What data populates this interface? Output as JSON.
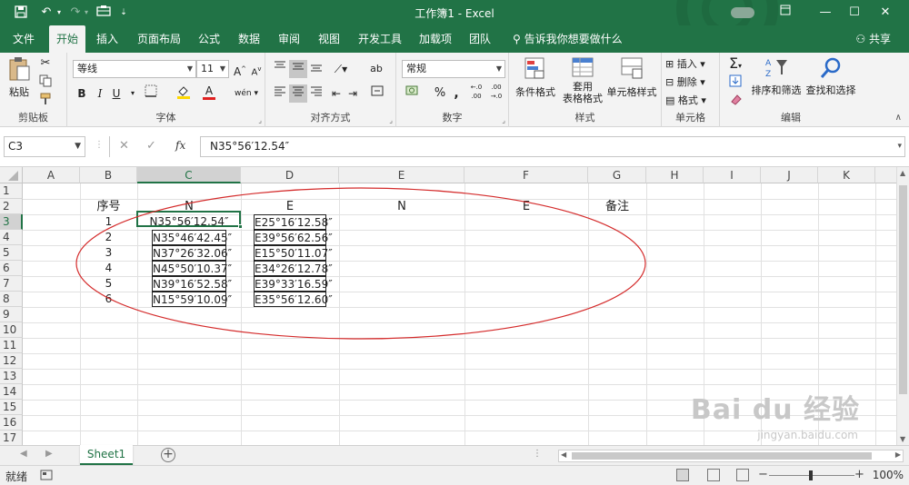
{
  "window": {
    "title": "工作簿1 - Excel",
    "quick_access": [
      "save-icon",
      "undo-icon",
      "redo-icon",
      "form-icon",
      "customize-icon"
    ],
    "controls": [
      "ribbon-display-icon",
      "minimize-icon",
      "maximize-icon",
      "close-icon"
    ]
  },
  "menu": {
    "tabs": [
      "文件",
      "开始",
      "插入",
      "页面布局",
      "公式",
      "数据",
      "审阅",
      "视图",
      "开发工具",
      "加载项",
      "团队"
    ],
    "active_tab": "开始",
    "tell_me": "告诉我你想要做什么",
    "share": "共享"
  },
  "ribbon": {
    "clipboard": {
      "label": "剪贴板",
      "paste": "粘贴"
    },
    "font": {
      "label": "字体",
      "font_name": "等线",
      "font_size": "11",
      "bold": "B",
      "italic": "I",
      "underline": "U",
      "grow": "A",
      "shrink": "A",
      "phonetic": "wén"
    },
    "alignment": {
      "label": "对齐方式",
      "wrap": "ab"
    },
    "number": {
      "label": "数字",
      "format": "常规",
      "percent": "%",
      "comma": ",",
      "inc_decimal": "←.0 .00",
      "dec_decimal": ".00 →.0"
    },
    "styles": {
      "label": "样式",
      "conditional": "条件格式",
      "table_format_1": "套用",
      "table_format_2": "表格格式",
      "cell_styles": "单元格样式"
    },
    "cells": {
      "label": "单元格",
      "insert": "插入",
      "delete": "删除",
      "format": "格式"
    },
    "editing": {
      "label": "编辑",
      "sort_filter": "排序和筛选",
      "find_select": "查找和选择",
      "sum": "Σ"
    }
  },
  "formula_bar": {
    "name_box": "C3",
    "cancel": "✕",
    "enter": "✓",
    "fx": "fx",
    "content": "N35°56′12.54″"
  },
  "sheet": {
    "columns": [
      "A",
      "B",
      "C",
      "D",
      "E",
      "F",
      "G",
      "H",
      "I",
      "J",
      "K"
    ],
    "selected_column": "C",
    "rows": [
      "1",
      "2",
      "3",
      "4",
      "5",
      "6",
      "7",
      "8",
      "9",
      "10",
      "11",
      "12",
      "13",
      "14",
      "15",
      "16",
      "17"
    ],
    "selected_row": "3",
    "headers": {
      "b": "序号",
      "c": "N",
      "d": "E",
      "e": "N",
      "f": "E",
      "g": "备注"
    },
    "data": [
      {
        "no": "1",
        "n": "N35°56′12.54″",
        "e": "E25°16′12.58″"
      },
      {
        "no": "2",
        "n": "N35°46′42.45″",
        "e": "E39°56′62.56″"
      },
      {
        "no": "3",
        "n": "N37°26′32.06″",
        "e": "E15°50′11.07″"
      },
      {
        "no": "4",
        "n": "N45°50′10.37″",
        "e": "E34°26′12.78″"
      },
      {
        "no": "5",
        "n": "N39°16′52.58″",
        "e": "E39°33′16.59″"
      },
      {
        "no": "6",
        "n": "N15°59′10.09″",
        "e": "E35°56′12.60″"
      }
    ],
    "annotation_color": "#d42b2b"
  },
  "sheet_tabs": {
    "active": "Sheet1",
    "add": "+"
  },
  "status": {
    "ready": "就绪",
    "zoom": "100%"
  },
  "watermark": {
    "main": "Bai du 经验",
    "sub": "jingyan.baidu.com"
  },
  "colors": {
    "accent": "#217346",
    "ribbon_bg": "#f3f3f3"
  }
}
